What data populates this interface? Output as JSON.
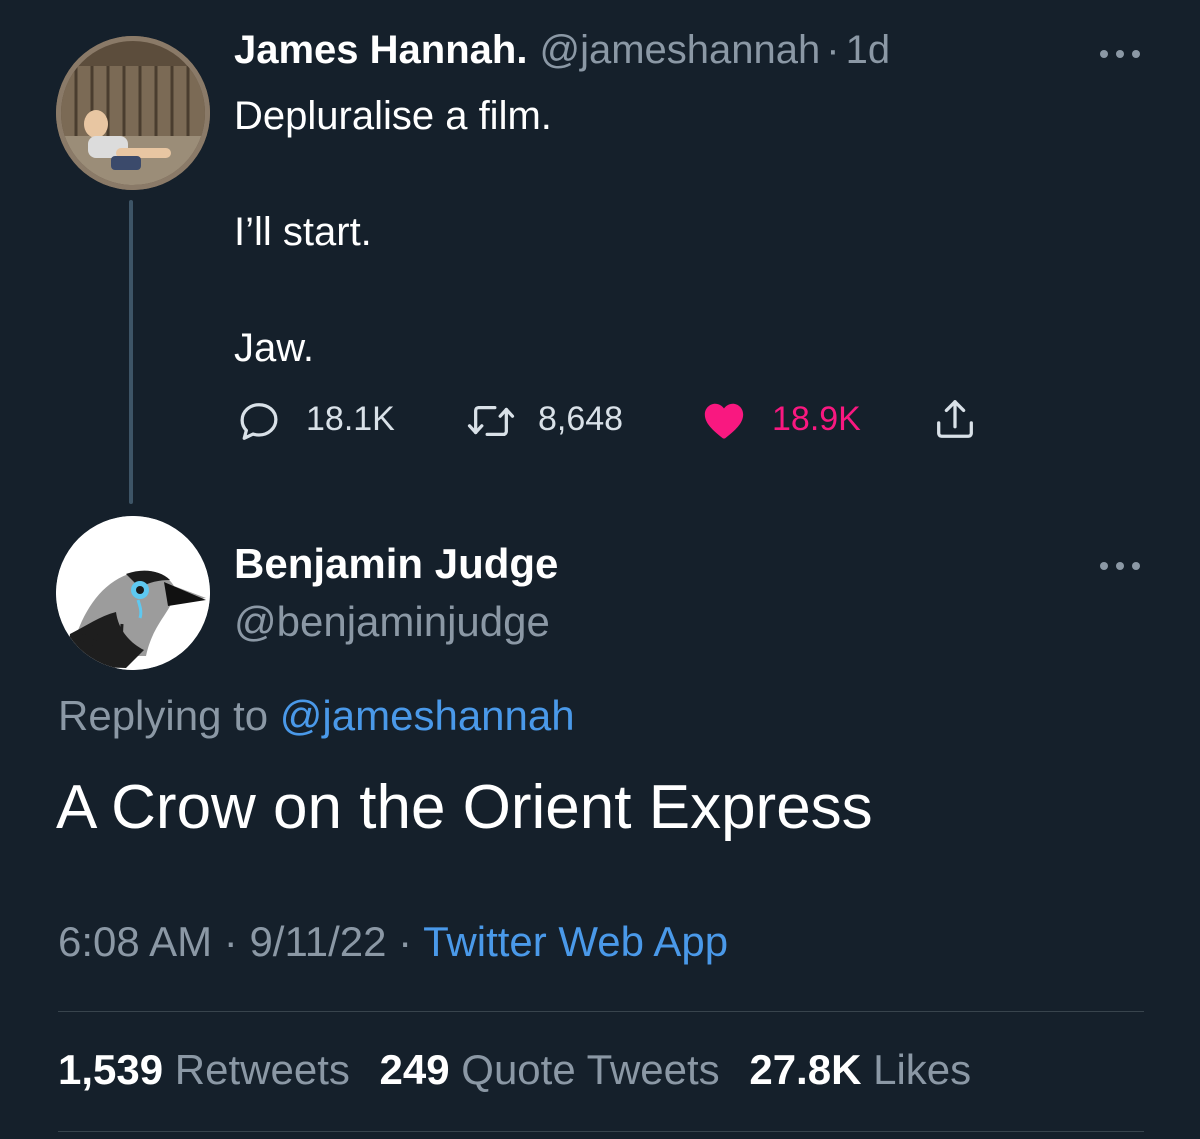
{
  "parent_tweet": {
    "display_name": "James Hannah.",
    "handle": "@jameshannah",
    "separator": "·",
    "age": "1d",
    "lines": [
      "Depluralise a film.",
      "I’ll start.",
      "Jaw."
    ],
    "actions": {
      "replies": "18.1K",
      "retweets": "8,648",
      "likes": "18.9K"
    },
    "icons": [
      "reply-icon",
      "retweet-icon",
      "heart-icon",
      "share-icon",
      "more-icon"
    ],
    "like_color": "#f91880"
  },
  "reply_tweet": {
    "display_name": "Benjamin Judge",
    "handle": "@benjaminjudge",
    "replying_prefix": "Replying to",
    "replying_handle": "@jameshannah",
    "text": "A Crow on the Orient Express",
    "time": "6:08 AM",
    "date": "9/11/22",
    "separator": "·",
    "source": "Twitter Web App",
    "stats": {
      "retweets_count": "1,539",
      "retweets_label": "Retweets",
      "quotes_count": "249",
      "quotes_label": "Quote Tweets",
      "likes_count": "27.8K",
      "likes_label": "Likes"
    }
  },
  "colors": {
    "background": "#15202b",
    "link": "#4a99e9",
    "muted": "#8b98a5"
  }
}
